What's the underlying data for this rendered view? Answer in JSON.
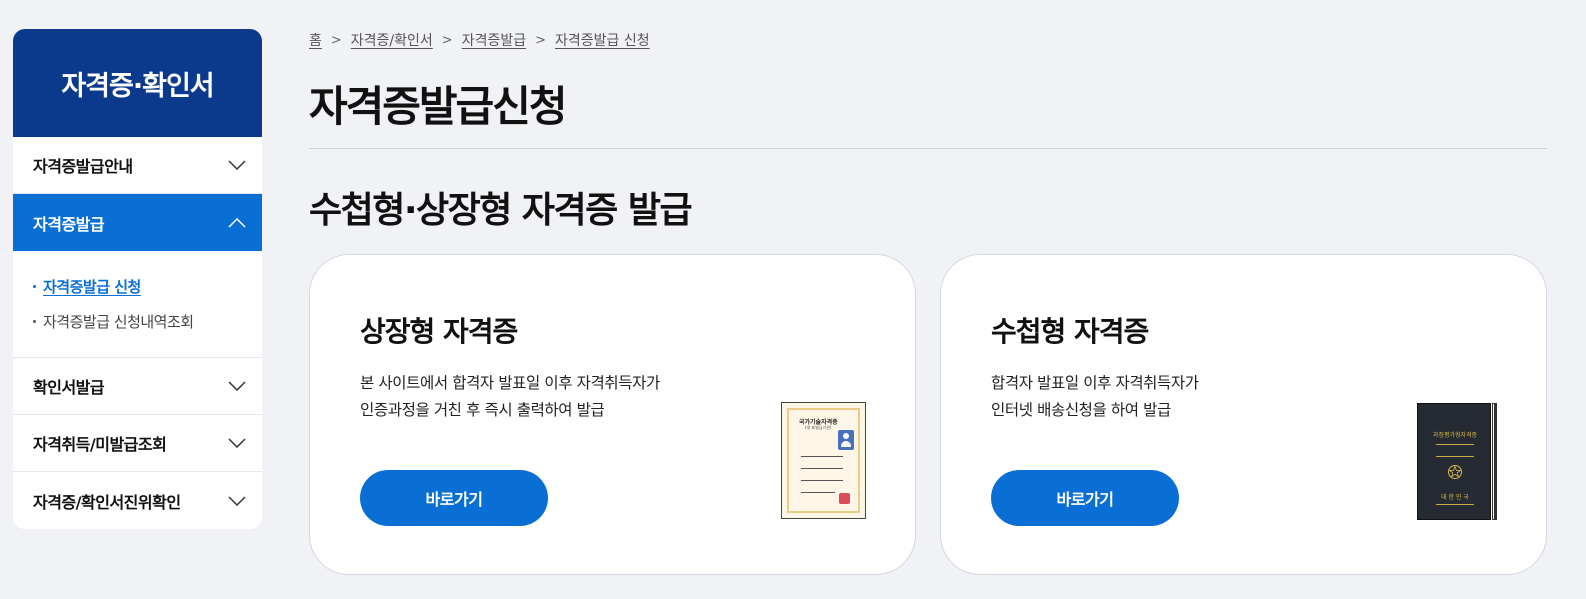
{
  "sidebar": {
    "header": "자격증·확인서",
    "items": [
      {
        "label": "자격증발급안내",
        "expanded": false
      },
      {
        "label": "자격증발급",
        "expanded": true,
        "subitems": [
          {
            "label": "자격증발급 신청",
            "current": true
          },
          {
            "label": "자격증발급 신청내역조회",
            "current": false
          }
        ]
      },
      {
        "label": "확인서발급",
        "expanded": false
      },
      {
        "label": "자격취득/미발급조회",
        "expanded": false
      },
      {
        "label": "자격증/확인서진위확인",
        "expanded": false
      }
    ]
  },
  "breadcrumb": [
    "홈",
    "자격증/확인서",
    "자격증발급",
    "자격증발급 신청"
  ],
  "page": {
    "title": "자격증발급신청",
    "section_title": "수첩형·상장형 자격증 발급"
  },
  "cards": [
    {
      "title": "상장형 자격증",
      "desc_line1": "본 사이트에서 합격자 발표일 이후 자격취득자가",
      "desc_line2": "인증과정을 거친 후 즉시 출력하여 발급",
      "button": "바로가기",
      "image": {
        "icon": "certificate-illustration",
        "title": "국가기술자격증",
        "subtitle": "(대 표발급기관)"
      }
    },
    {
      "title": "수첩형 자격증",
      "desc_line1": "합격자 발표일 이후 자격취득자가",
      "desc_line2": "인터넷 배송신청을 하여 발급",
      "button": "바로가기",
      "image": {
        "icon": "passbook-illustration",
        "title": "과정평가형자격증",
        "bottom": "대 한 민 국"
      }
    }
  ],
  "colors": {
    "brand_navy": "#0b3a8c",
    "accent_blue": "#0a6fd4",
    "background": "#f1f2f5"
  }
}
